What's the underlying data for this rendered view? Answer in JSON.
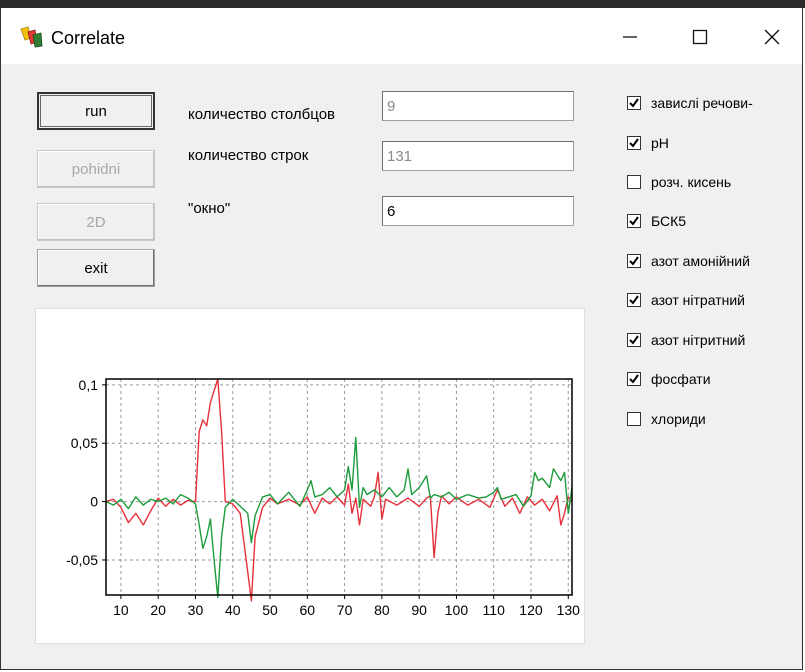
{
  "window": {
    "title": "Correlate",
    "icon": "delphi-app-icon"
  },
  "buttons": {
    "run": "run",
    "pohidni": "pohidni",
    "twoD": "2D",
    "exit": "exit"
  },
  "fields": {
    "columns": {
      "label": "количество столбцов",
      "value": "9"
    },
    "rows": {
      "label": "количество строк",
      "value": "131"
    },
    "window": {
      "label": "\"окно\"",
      "value": "6"
    }
  },
  "checkboxes": [
    {
      "label": "завислі речови-",
      "checked": true
    },
    {
      "label": "pH",
      "checked": true
    },
    {
      "label": "розч. кисень",
      "checked": false
    },
    {
      "label": "БСК5",
      "checked": true
    },
    {
      "label": "азот амонійний",
      "checked": true
    },
    {
      "label": "азот нітратний",
      "checked": true
    },
    {
      "label": "азот нітритний",
      "checked": true
    },
    {
      "label": "фосфати",
      "checked": true
    },
    {
      "label": "хлориди",
      "checked": false
    }
  ],
  "chart_data": {
    "type": "line",
    "title": "",
    "xlabel": "",
    "ylabel": "",
    "xlim": [
      6,
      131
    ],
    "ylim": [
      -0.08,
      0.105
    ],
    "x_ticks": [
      10,
      20,
      30,
      40,
      50,
      60,
      70,
      80,
      90,
      100,
      110,
      120,
      130
    ],
    "x_tick_labels": [
      "10",
      "20",
      "30",
      "40",
      "50",
      "60",
      "70",
      "80",
      "90",
      "100",
      "110",
      "120",
      "130"
    ],
    "y_ticks": [
      0.1,
      0.05,
      0,
      -0.05
    ],
    "y_tick_labels": [
      "0,1",
      "0,05",
      "0",
      "-0,05"
    ],
    "grid": true,
    "legend": "none",
    "series": [
      {
        "color": "#e8303a",
        "points": [
          [
            6,
            0
          ],
          [
            8,
            0.002
          ],
          [
            10,
            -0.005
          ],
          [
            12,
            -0.018
          ],
          [
            14,
            -0.01
          ],
          [
            16,
            -0.02
          ],
          [
            18,
            -0.008
          ],
          [
            20,
            0.003
          ],
          [
            22,
            -0.004
          ],
          [
            24,
            0.002
          ],
          [
            26,
            -0.003
          ],
          [
            28,
            0.001
          ],
          [
            30,
            0
          ],
          [
            31,
            0.06
          ],
          [
            32,
            0.07
          ],
          [
            33,
            0.065
          ],
          [
            34,
            0.085
          ],
          [
            35,
            0.095
          ],
          [
            36,
            0.105
          ],
          [
            37,
            0.06
          ],
          [
            38,
            0
          ],
          [
            40,
            -0.002
          ],
          [
            42,
            -0.01
          ],
          [
            44,
            -0.06
          ],
          [
            45,
            -0.085
          ],
          [
            46,
            -0.03
          ],
          [
            48,
            -0.005
          ],
          [
            50,
            0.003
          ],
          [
            52,
            -0.002
          ],
          [
            55,
            0.002
          ],
          [
            58,
            -0.003
          ],
          [
            60,
            0.004
          ],
          [
            62,
            -0.01
          ],
          [
            64,
            0.003
          ],
          [
            66,
            -0.002
          ],
          [
            68,
            0.004
          ],
          [
            70,
            -0.003
          ],
          [
            71,
            0.015
          ],
          [
            72,
            -0.01
          ],
          [
            73,
            0.003
          ],
          [
            74,
            -0.02
          ],
          [
            75,
            0.002
          ],
          [
            77,
            -0.004
          ],
          [
            78,
            0.004
          ],
          [
            79,
            0.025
          ],
          [
            80,
            -0.015
          ],
          [
            81,
            0.002
          ],
          [
            84,
            -0.003
          ],
          [
            87,
            0.003
          ],
          [
            90,
            -0.004
          ],
          [
            92,
            0.003
          ],
          [
            93,
            0.005
          ],
          [
            94,
            -0.048
          ],
          [
            95,
            -0.01
          ],
          [
            96,
            0.005
          ],
          [
            98,
            -0.002
          ],
          [
            100,
            0.004
          ],
          [
            103,
            -0.003
          ],
          [
            106,
            0.002
          ],
          [
            109,
            -0.005
          ],
          [
            111,
            0.01
          ],
          [
            113,
            -0.004
          ],
          [
            115,
            0.003
          ],
          [
            117,
            -0.01
          ],
          [
            119,
            0.004
          ],
          [
            121,
            -0.003
          ],
          [
            123,
            0.002
          ],
          [
            125,
            -0.008
          ],
          [
            127,
            0.005
          ],
          [
            128,
            -0.02
          ],
          [
            129,
            -0.01
          ],
          [
            130,
            0.004
          ],
          [
            131,
            0.0
          ]
        ]
      },
      {
        "color": "#1e9b3a",
        "points": [
          [
            6,
            0
          ],
          [
            8,
            -0.003
          ],
          [
            10,
            0.002
          ],
          [
            12,
            -0.006
          ],
          [
            14,
            0.004
          ],
          [
            16,
            -0.003
          ],
          [
            18,
            0.002
          ],
          [
            20,
            0.0
          ],
          [
            22,
            0.003
          ],
          [
            24,
            -0.002
          ],
          [
            26,
            0.006
          ],
          [
            28,
            0.003
          ],
          [
            30,
            -0.002
          ],
          [
            31,
            -0.02
          ],
          [
            32,
            -0.04
          ],
          [
            33,
            -0.03
          ],
          [
            34,
            -0.015
          ],
          [
            35,
            -0.05
          ],
          [
            36,
            -0.082
          ],
          [
            37,
            -0.03
          ],
          [
            38,
            -0.005
          ],
          [
            40,
            0.002
          ],
          [
            42,
            -0.004
          ],
          [
            44,
            -0.01
          ],
          [
            45,
            -0.035
          ],
          [
            46,
            -0.012
          ],
          [
            48,
            0.004
          ],
          [
            50,
            0.006
          ],
          [
            52,
            -0.002
          ],
          [
            55,
            0.008
          ],
          [
            58,
            -0.004
          ],
          [
            60,
            0.01
          ],
          [
            61,
            0.018
          ],
          [
            62,
            0.004
          ],
          [
            64,
            0.006
          ],
          [
            66,
            0.012
          ],
          [
            68,
            0.004
          ],
          [
            70,
            0.01
          ],
          [
            71,
            0.03
          ],
          [
            72,
            0.01
          ],
          [
            73,
            0.055
          ],
          [
            74,
            -0.005
          ],
          [
            75,
            0.012
          ],
          [
            76,
            0.006
          ],
          [
            78,
            0.01
          ],
          [
            80,
            0.004
          ],
          [
            82,
            0.012
          ],
          [
            84,
            0.004
          ],
          [
            86,
            0.01
          ],
          [
            87,
            0.028
          ],
          [
            88,
            0.006
          ],
          [
            90,
            0.012
          ],
          [
            92,
            0.022
          ],
          [
            93,
            0.003
          ],
          [
            94,
            0.006
          ],
          [
            96,
            0.004
          ],
          [
            98,
            0.008
          ],
          [
            100,
            0.002
          ],
          [
            103,
            0.006
          ],
          [
            106,
            0.003
          ],
          [
            108,
            0.004
          ],
          [
            110,
            0.008
          ],
          [
            111,
            0.012
          ],
          [
            112,
            0.002
          ],
          [
            114,
            0.004
          ],
          [
            116,
            0.006
          ],
          [
            118,
            -0.004
          ],
          [
            120,
            0.005
          ],
          [
            121,
            0.025
          ],
          [
            122,
            0.018
          ],
          [
            123,
            0.02
          ],
          [
            125,
            0.012
          ],
          [
            126,
            0.028
          ],
          [
            128,
            0.018
          ],
          [
            129,
            0.025
          ],
          [
            130,
            -0.01
          ],
          [
            131,
            0.012
          ]
        ]
      }
    ]
  }
}
